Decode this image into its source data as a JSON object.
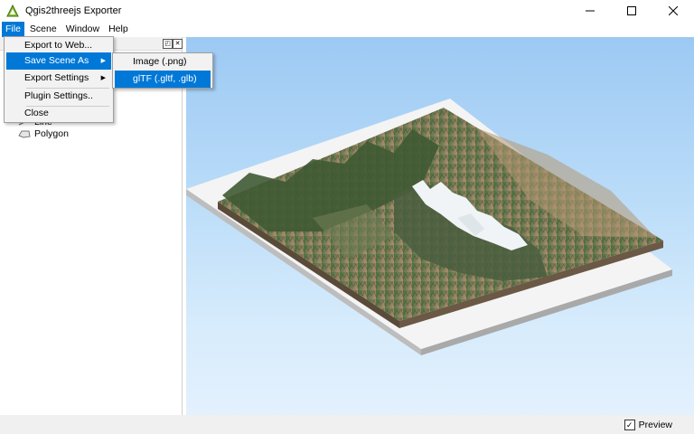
{
  "window": {
    "title": "Qgis2threejs Exporter"
  },
  "menubar": {
    "items": [
      "File",
      "Scene",
      "Window",
      "Help"
    ]
  },
  "file_menu": {
    "items": [
      "Export to Web...",
      "Save Scene As",
      "Export Settings",
      "Plugin Settings..",
      "Close"
    ]
  },
  "save_submenu": {
    "items": [
      "Image (.png)",
      "glTF (.gltf, .glb)"
    ]
  },
  "layers": {
    "items": [
      "Line",
      "Polygon"
    ]
  },
  "status": {
    "preview_label": "Preview",
    "preview_checked": true
  }
}
